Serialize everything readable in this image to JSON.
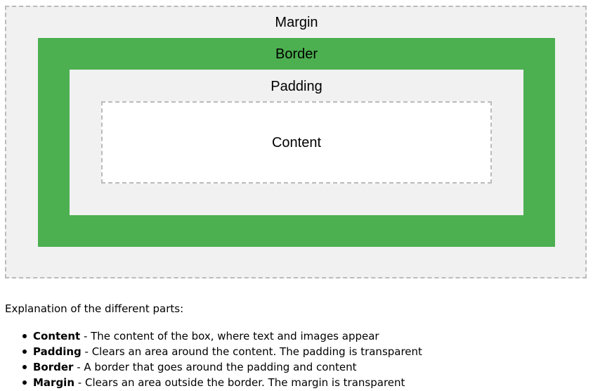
{
  "diagram": {
    "margin_label": "Margin",
    "border_label": "Border",
    "padding_label": "Padding",
    "content_label": "Content",
    "colors": {
      "margin_background": "#f1f1f1",
      "border_background": "#4caf50",
      "padding_background": "#f1f1f1",
      "content_background": "#ffffff",
      "dashed_outline": "#bbbbbb"
    }
  },
  "explanation": {
    "heading": "Explanation of the different parts:",
    "items": [
      {
        "term": "Content",
        "description": " - The content of the box, where text and images appear"
      },
      {
        "term": "Padding",
        "description": " - Clears an area around the content. The padding is transparent"
      },
      {
        "term": "Border",
        "description": " - A border that goes around the padding and content"
      },
      {
        "term": "Margin",
        "description": " - Clears an area outside the border. The margin is transparent"
      }
    ]
  }
}
